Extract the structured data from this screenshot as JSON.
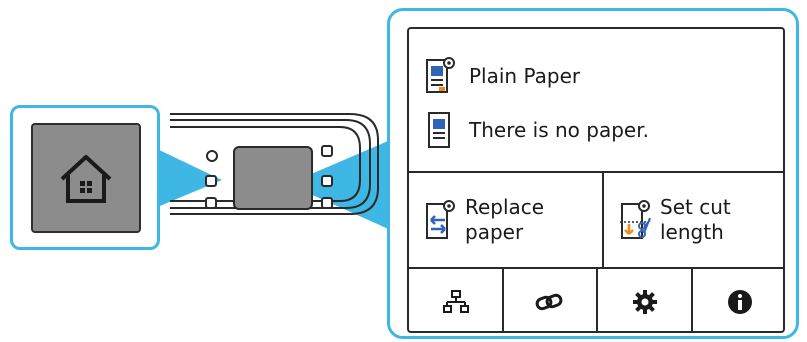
{
  "screen": {
    "media_status": {
      "label": "Plain Paper",
      "icon": "roll-paper-icon"
    },
    "paper_status": {
      "label": "There is no paper.",
      "icon": "paper-sheet-icon"
    }
  },
  "actions": {
    "replace_paper": {
      "line1": "Replace",
      "line2": "paper",
      "icon": "replace-paper-icon"
    },
    "set_cut_length": {
      "line1": "Set cut",
      "line2": "length",
      "icon": "cut-length-icon"
    }
  },
  "bottom_bar": {
    "items": [
      {
        "icon": "network-icon"
      },
      {
        "icon": "wireless-connect-icon"
      },
      {
        "icon": "settings-gear-icon"
      },
      {
        "icon": "info-icon"
      }
    ]
  },
  "colors": {
    "callout_border": "#3fb7e4",
    "callout_pointer": "#3fb7e4",
    "home_button_fill": "#8c8c8c",
    "icon_blue": "#2f64b8",
    "icon_orange": "#f08a1c"
  }
}
